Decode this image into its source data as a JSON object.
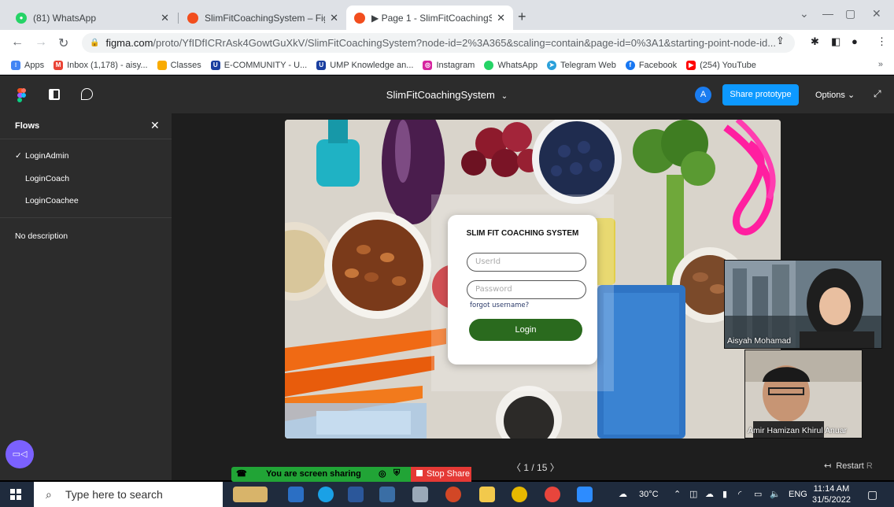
{
  "browser": {
    "tabs": [
      {
        "title": "(81) WhatsApp",
        "icon": "whatsapp-icon"
      },
      {
        "title": "SlimFitCoachingSystem – Figma",
        "icon": "figma-icon"
      },
      {
        "title": "▶ Page 1 - SlimFitCoachingSyste",
        "icon": "figma-icon"
      }
    ],
    "url_domain": "figma.com",
    "url_path": "/proto/YfIDfICRrAsk4GowtGuXkV/SlimFitCoachingSystem?node-id=2%3A365&scaling=contain&page-id=0%3A1&starting-point-node-id...",
    "bookmarks": [
      {
        "label": "Apps",
        "color": "#4285f4"
      },
      {
        "label": "Inbox (1,178) - aisy...",
        "color": "#ea4335"
      },
      {
        "label": "Classes",
        "color": "#f9ab00"
      },
      {
        "label": "E-COMMUNITY - U...",
        "color": "#1a3fa0"
      },
      {
        "label": "UMP Knowledge an...",
        "color": "#1a3fa0"
      },
      {
        "label": "Instagram",
        "color": "#d6249f"
      },
      {
        "label": "WhatsApp",
        "color": "#25d366"
      },
      {
        "label": "Telegram Web",
        "color": "#2aa0da"
      },
      {
        "label": "Facebook",
        "color": "#1877f2"
      },
      {
        "label": "(254) YouTube",
        "color": "#ff0000"
      }
    ],
    "bookmarks_more": "»"
  },
  "figma": {
    "project_title": "SlimFitCoachingSystem",
    "avatar_initial": "A",
    "share_label": "Share prototype",
    "options_label": "Options",
    "flows_title": "Flows",
    "flows": [
      "LoginAdmin",
      "LoginCoach",
      "LoginCoachee"
    ],
    "active_flow": "LoginAdmin",
    "no_description": "No description",
    "pager": "1 / 15",
    "restart_label": "Restart",
    "restart_key": "R"
  },
  "login": {
    "title": "SLIM FIT COACHING SYSTEM",
    "userid_placeholder": "UserId",
    "password_placeholder": "Password",
    "forgot": "forgot username?",
    "button": "Login"
  },
  "call": {
    "participant1": "Aisyah Mohamad",
    "participant2": "Amir Hamizan Khirul Anuar",
    "sharing_text": "You are screen sharing",
    "stop_share": "Stop Share"
  },
  "taskbar": {
    "search_placeholder": "Type here to search",
    "temperature": "30°C",
    "language": "ENG",
    "time": "11:14 AM",
    "date": "31/5/2022"
  },
  "colors": {
    "figma_dark": "#2c2c2c",
    "share_blue": "#0d99ff",
    "login_green": "#2a6a1e",
    "sharing_green": "#21a436",
    "stop_red": "#e53935"
  }
}
